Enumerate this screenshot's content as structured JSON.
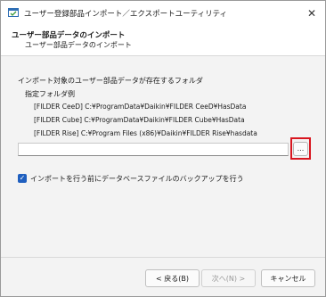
{
  "window": {
    "title": "ユーザー登録部品インポート／エクスポートユーティリティ",
    "close_glyph": "✕"
  },
  "header": {
    "title": "ユーザー部品データのインポート",
    "subtitle": "ユーザー部品データのインポート"
  },
  "main": {
    "folder_label": "インポート対象のユーザー部品データが存在するフォルダ",
    "example_label": "指定フォルダ例",
    "examples": [
      "[FILDER CeeD] C:¥ProgramData¥Daikin¥FILDER CeeD¥HasData",
      "[FILDER Cube] C:¥ProgramData¥Daikin¥FILDER Cube¥HasData",
      "[FILDER Rise] C:¥Program Files (x86)¥Daikin¥FILDER Rise¥hasdata"
    ],
    "path_value": "",
    "browse_label": "...",
    "backup_checkbox": {
      "label": "インポートを行う前にデータベースファイルのバックアップを行う",
      "checked": true
    }
  },
  "footer": {
    "back_label": "< 戻る(B)",
    "next_label": "次へ(N) >",
    "cancel_label": "キャンセル"
  },
  "colors": {
    "highlight": "#d8161f",
    "checkbox_accent": "#1f5fbf"
  }
}
